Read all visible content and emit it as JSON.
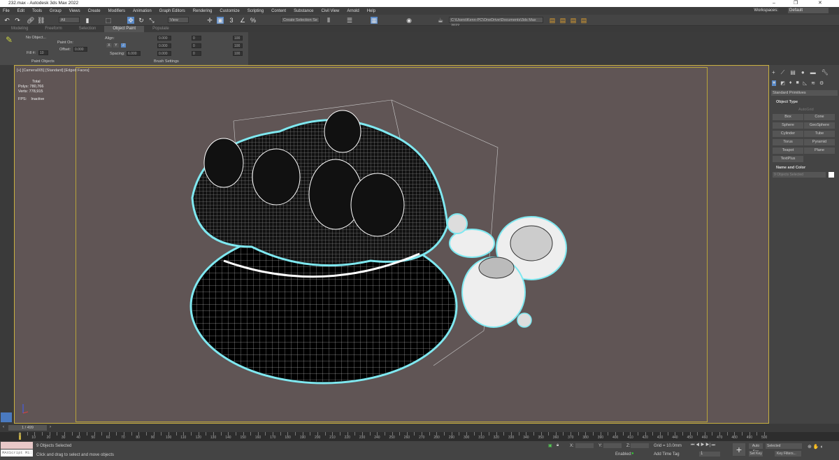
{
  "window": {
    "title": "232.max - Autodesk 3ds Max 2022",
    "minimize": "–",
    "maximize": "❐",
    "close": "✕"
  },
  "menu": [
    "File",
    "Edit",
    "Tools",
    "Group",
    "Views",
    "Create",
    "Modifiers",
    "Animation",
    "Graph Editors",
    "Rendering",
    "Customize",
    "Scripting",
    "Content",
    "Substance",
    "Civil View",
    "Arnold",
    "Help"
  ],
  "workspaces": {
    "label": "Workspaces:",
    "value": "Default"
  },
  "toolbar": {
    "filter": "All",
    "view_dropdown": "View",
    "selection_set": "Create Selection Se",
    "project_path": "C:\\Users\\Kenn-PC\\OneDrive\\Documents\\3ds Max 2022"
  },
  "ribbon_tabs": [
    {
      "label": "Modeling",
      "active": false
    },
    {
      "label": "Freeform",
      "active": false
    },
    {
      "label": "Selection",
      "active": false
    },
    {
      "label": "Object Paint",
      "active": true
    },
    {
      "label": "Populate",
      "active": false
    }
  ],
  "ribbon": {
    "paint_objects": {
      "object": "No Object...",
      "paint_on": "Paint On:",
      "offset_label": "Offset:",
      "offset": "0.000",
      "fill_label": "Fill #:",
      "fill": "10",
      "group": "Paint Objects"
    },
    "brush": {
      "align": "Align:",
      "axes": [
        "X",
        "Y",
        "Z"
      ],
      "spacing_label": "Spacing:",
      "spacing": "6.000",
      "u": "0.000",
      "v": "0.000",
      "w": "0.000",
      "x": "0",
      "y": "0",
      "z": "0",
      "sx": "100",
      "sy": "100",
      "sz": "100",
      "group": "Brush Settings"
    }
  },
  "viewport": {
    "label": "[+] [Camera005] [Standard] [Edged Faces]",
    "stats": {
      "header": "Total",
      "polys_label": "Polys:",
      "polys": "780,766",
      "verts_label": "Verts:",
      "verts": "778,915",
      "fps_label": "FPS:",
      "fps": "Inactive"
    },
    "background": "#605555",
    "selection_outline": "#7fe8f0"
  },
  "command_panel": {
    "dropdown": "Standard Primitives",
    "object_type": "Object Type",
    "autogrid": "AutoGrid",
    "buttons": [
      "Box",
      "Cone",
      "Sphere",
      "GeoSphere",
      "Cylinder",
      "Tube",
      "Torus",
      "Pyramid",
      "Teapot",
      "Plane",
      "TextPlus"
    ],
    "name_and_color": "Name and Color",
    "name_field": "9 Objects Selected"
  },
  "timeline": {
    "frame": "1 / 499",
    "ticks": [
      10,
      20,
      30,
      40,
      50,
      60,
      70,
      80,
      90,
      100,
      110,
      120,
      130,
      140,
      150,
      160,
      170,
      180,
      190,
      200,
      210,
      220,
      230,
      240,
      250,
      260,
      270,
      280,
      290,
      300,
      310,
      320,
      330,
      340,
      350,
      360,
      370,
      380,
      390,
      400,
      410,
      420,
      430,
      440,
      450,
      460,
      470,
      480,
      490,
      500
    ]
  },
  "status": {
    "maxscript": "MAXScript Mi:",
    "selected": "9 Objects Selected",
    "prompt": "Click and drag to select and move objects",
    "x_label": "X:",
    "y_label": "Y:",
    "z_label": "Z:",
    "grid": "Grid = 10.0mm",
    "enabled": "Enabled:",
    "add_time_tag": "Add Time Tag",
    "auto_key": "Auto Key",
    "set_key": "Set Key",
    "key_mode": "Selected",
    "key_filters": "Key Filters...",
    "current_frame": "1"
  }
}
